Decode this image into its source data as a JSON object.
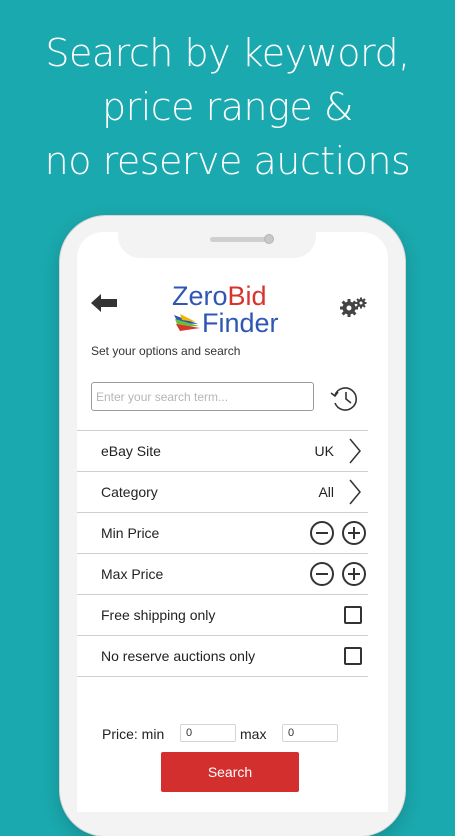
{
  "promo": {
    "line1": "Search by keyword,",
    "line2": "price range &",
    "line3": "no reserve auctions"
  },
  "colors": {
    "background": "#1aa9ae",
    "brand_blue": "#2e57b3",
    "brand_red": "#d8332e",
    "button_red": "#d32f2f"
  },
  "header": {
    "back_icon": "back-arrow-icon",
    "logo_part1": "Zero",
    "logo_part2": "Bid",
    "logo_part3": "Finder",
    "settings_icon": "gear-icon"
  },
  "subtitle": "Set your options and search",
  "search": {
    "placeholder": "Enter your search term...",
    "value": "",
    "history_icon": "history-clock-icon"
  },
  "options": [
    {
      "label": "eBay Site",
      "value": "UK",
      "control": "chevron"
    },
    {
      "label": "Category",
      "value": "All",
      "control": "chevron"
    },
    {
      "label": "Min Price",
      "control": "stepper"
    },
    {
      "label": "Max Price",
      "control": "stepper"
    },
    {
      "label": "Free shipping only",
      "control": "checkbox",
      "checked": false
    },
    {
      "label": "No reserve auctions only",
      "control": "checkbox",
      "checked": false
    }
  ],
  "price": {
    "min_label": "Price: min",
    "min_value": "0",
    "max_label": "max",
    "max_value": "0"
  },
  "search_button": "Search"
}
